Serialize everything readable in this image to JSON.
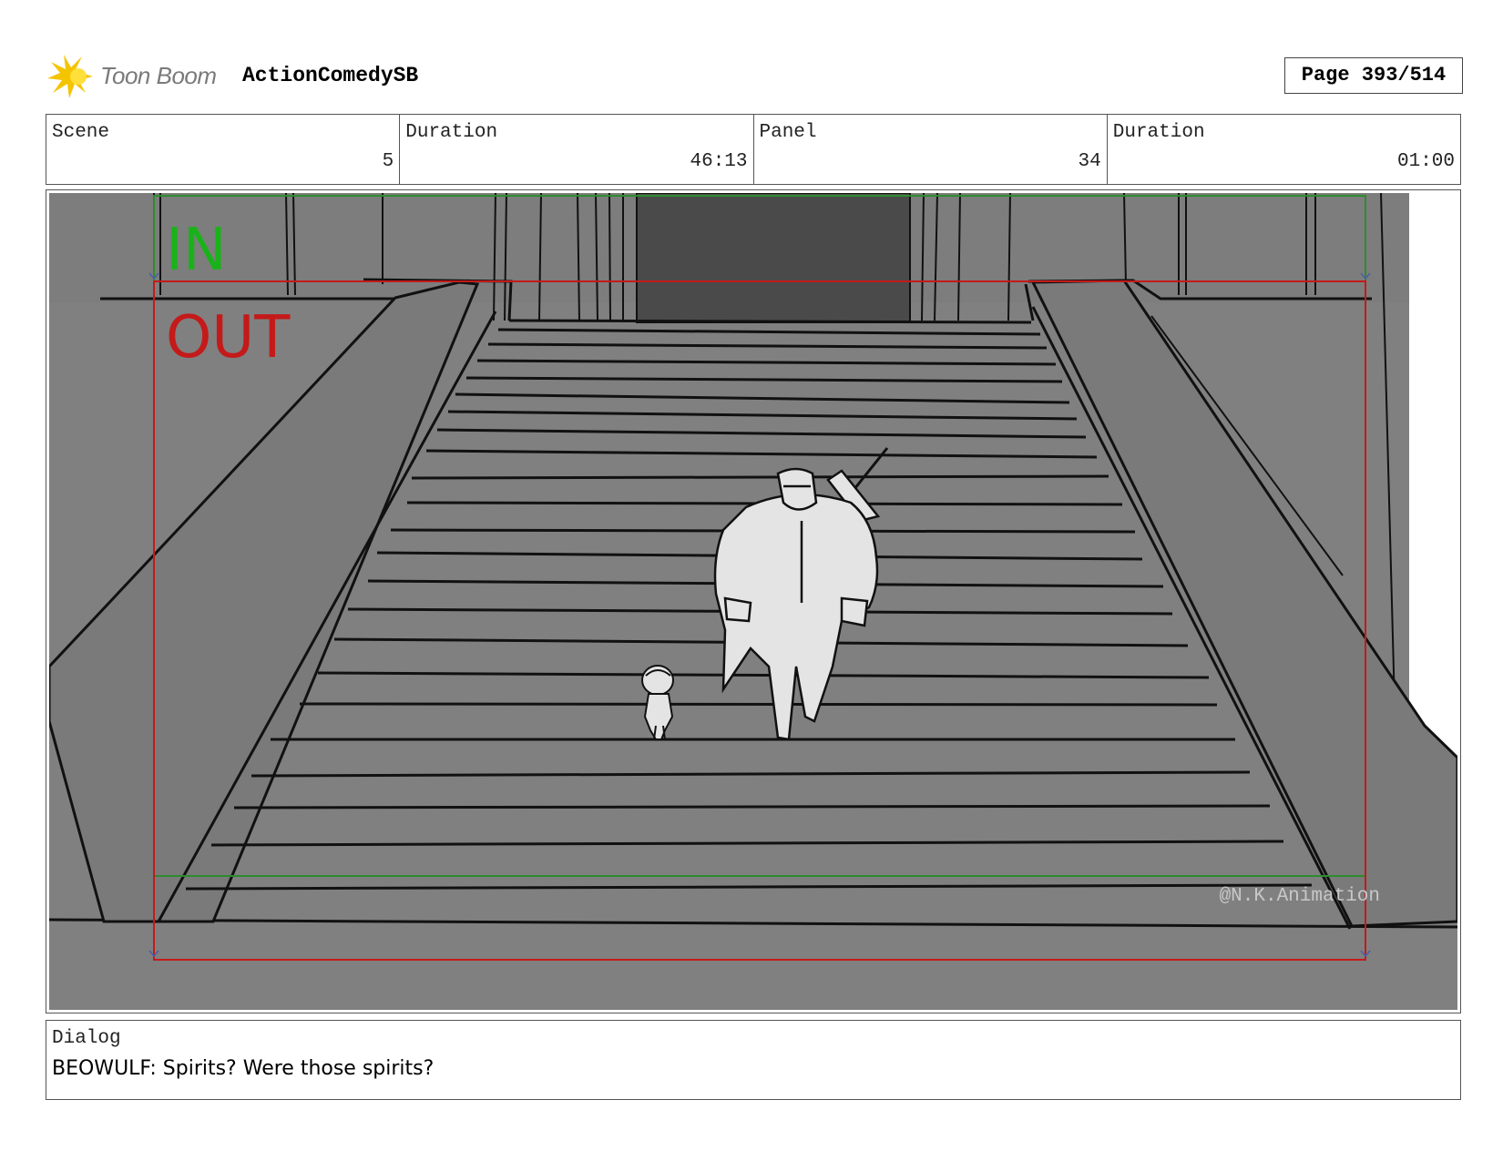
{
  "header": {
    "logo_text": "Toon Boom",
    "project_name": "ActionComedySB",
    "page_label": "Page 393/514"
  },
  "info": [
    {
      "label": "Scene",
      "value": "5"
    },
    {
      "label": "Duration",
      "value": "46:13"
    },
    {
      "label": "Panel",
      "value": "34"
    },
    {
      "label": "Duration",
      "value": "01:00"
    }
  ],
  "panel": {
    "in_label": "IN",
    "out_label": "OUT",
    "watermark": "@N.K.Animation",
    "colors": {
      "background": "#808080",
      "doorway": "#4a4a4a",
      "in_frame": "#2e8b2e",
      "out_frame": "#c41a1a",
      "figures": "#e4e4e4"
    }
  },
  "dialog": {
    "label": "Dialog",
    "text": "BEOWULF: Spirits? Were those spirits?"
  }
}
